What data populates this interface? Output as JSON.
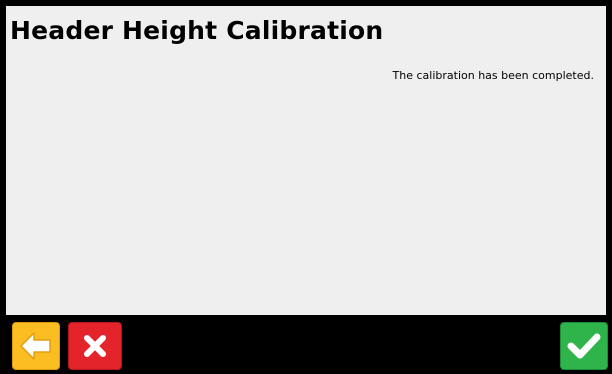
{
  "screen": {
    "title": "Header Height Calibration",
    "message": "The calibration has been completed."
  },
  "toolbar": {
    "back": {
      "icon": "arrow-left-icon",
      "color": "#fbbd21"
    },
    "cancel": {
      "icon": "close-icon",
      "color": "#e3242b"
    },
    "confirm": {
      "icon": "checkmark-icon",
      "color": "#2fb44b"
    }
  }
}
